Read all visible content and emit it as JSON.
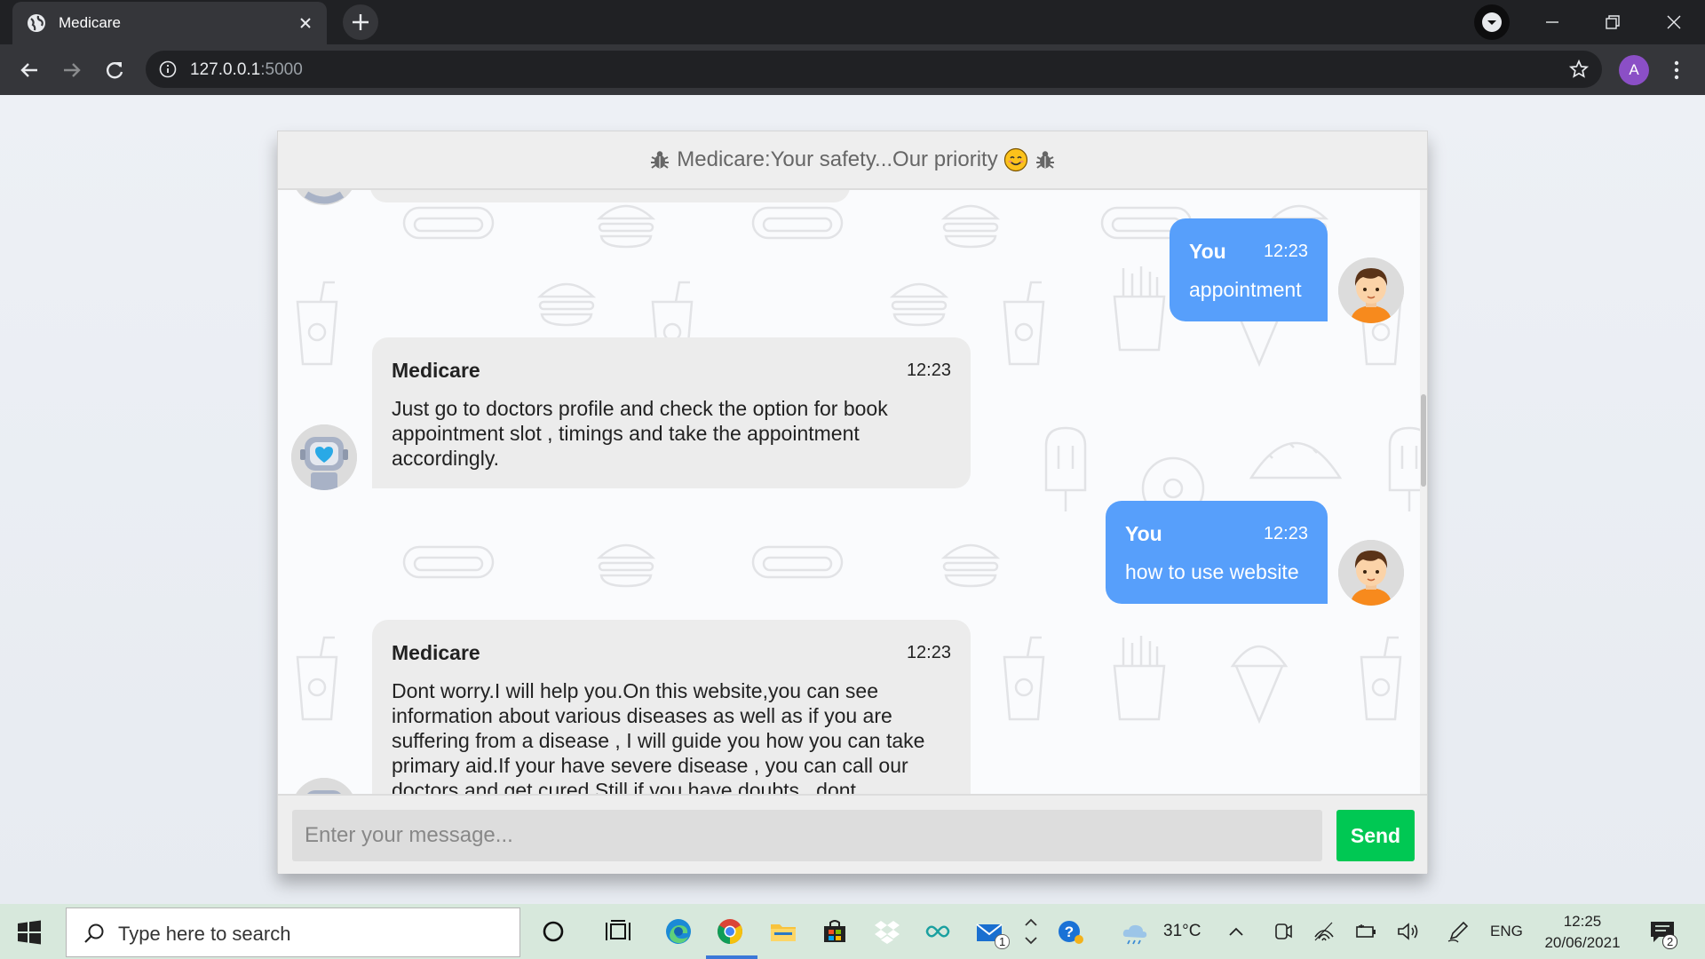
{
  "browser": {
    "tab_title": "Medicare",
    "url_host": "127.0.0.1",
    "url_port": ":5000",
    "profile_initial": "A"
  },
  "chat": {
    "header_title": "Medicare:Your safety...Our priority",
    "messages": [
      {
        "sender": "You",
        "time": "12:23",
        "text": "appointment",
        "side": "right"
      },
      {
        "sender": "Medicare",
        "time": "12:23",
        "text": "Just go to doctors profile and check the option for book appointment slot , timings and take the appointment accordingly.",
        "side": "left"
      },
      {
        "sender": "You",
        "time": "12:23",
        "text": "how to use website",
        "side": "right"
      },
      {
        "sender": "Medicare",
        "time": "12:23",
        "text": "Dont worry.I will help you.On this website,you can see information about various diseases as well as if you are suffering from a disease , I will guide you how you can take primary aid.If your have severe disease , you can call our doctors and get cured.Still if you have doubts , dont",
        "side": "left"
      }
    ],
    "input_placeholder": "Enter your message...",
    "send_label": "Send"
  },
  "taskbar": {
    "search_placeholder": "Type here to search",
    "weather": "31°C",
    "language": "ENG",
    "time": "12:25",
    "date": "20/06/2021",
    "mail_badge": "1",
    "notification_badge": "2"
  },
  "colors": {
    "user_bubble": "#579ffb",
    "bot_bubble": "#ececec",
    "send_button": "#00c853"
  }
}
